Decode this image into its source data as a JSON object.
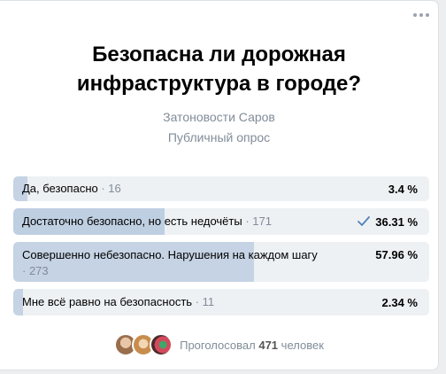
{
  "poll": {
    "title": "Безопасна ли дорожная инфраструктура в городе?",
    "author": "Затоновости Саров",
    "type": "Публичный опрос",
    "options": [
      {
        "label": "Да, безопасно",
        "count": "16",
        "percent": "3.4 %",
        "fraction": 0.034,
        "chosen": false
      },
      {
        "label": "Достаточно безопасно, но есть недочёты",
        "count": "171",
        "percent": "36.31 %",
        "fraction": 0.3631,
        "chosen": true
      },
      {
        "label": "Совершенно небезопасно. Нарушения на каждом шагу",
        "count": "273",
        "percent": "57.96 %",
        "fraction": 0.5796,
        "chosen": false
      },
      {
        "label": "Мне всё равно на безопасность",
        "count": "11",
        "percent": "2.34 %",
        "fraction": 0.0234,
        "chosen": false
      }
    ],
    "voted_prefix": "Проголосовал",
    "voted_count": "471",
    "voted_suffix": "человек"
  },
  "icons": {
    "more": "more-horizontal-icon",
    "check": "check-icon"
  },
  "colors": {
    "bar_fill": "#c5d3e4",
    "bar_bg": "#eef1f4",
    "check": "#5181b8",
    "avatar1": "#c9a27e",
    "avatar2": "#d9a86c",
    "avatar3": "#6a3b3b"
  }
}
